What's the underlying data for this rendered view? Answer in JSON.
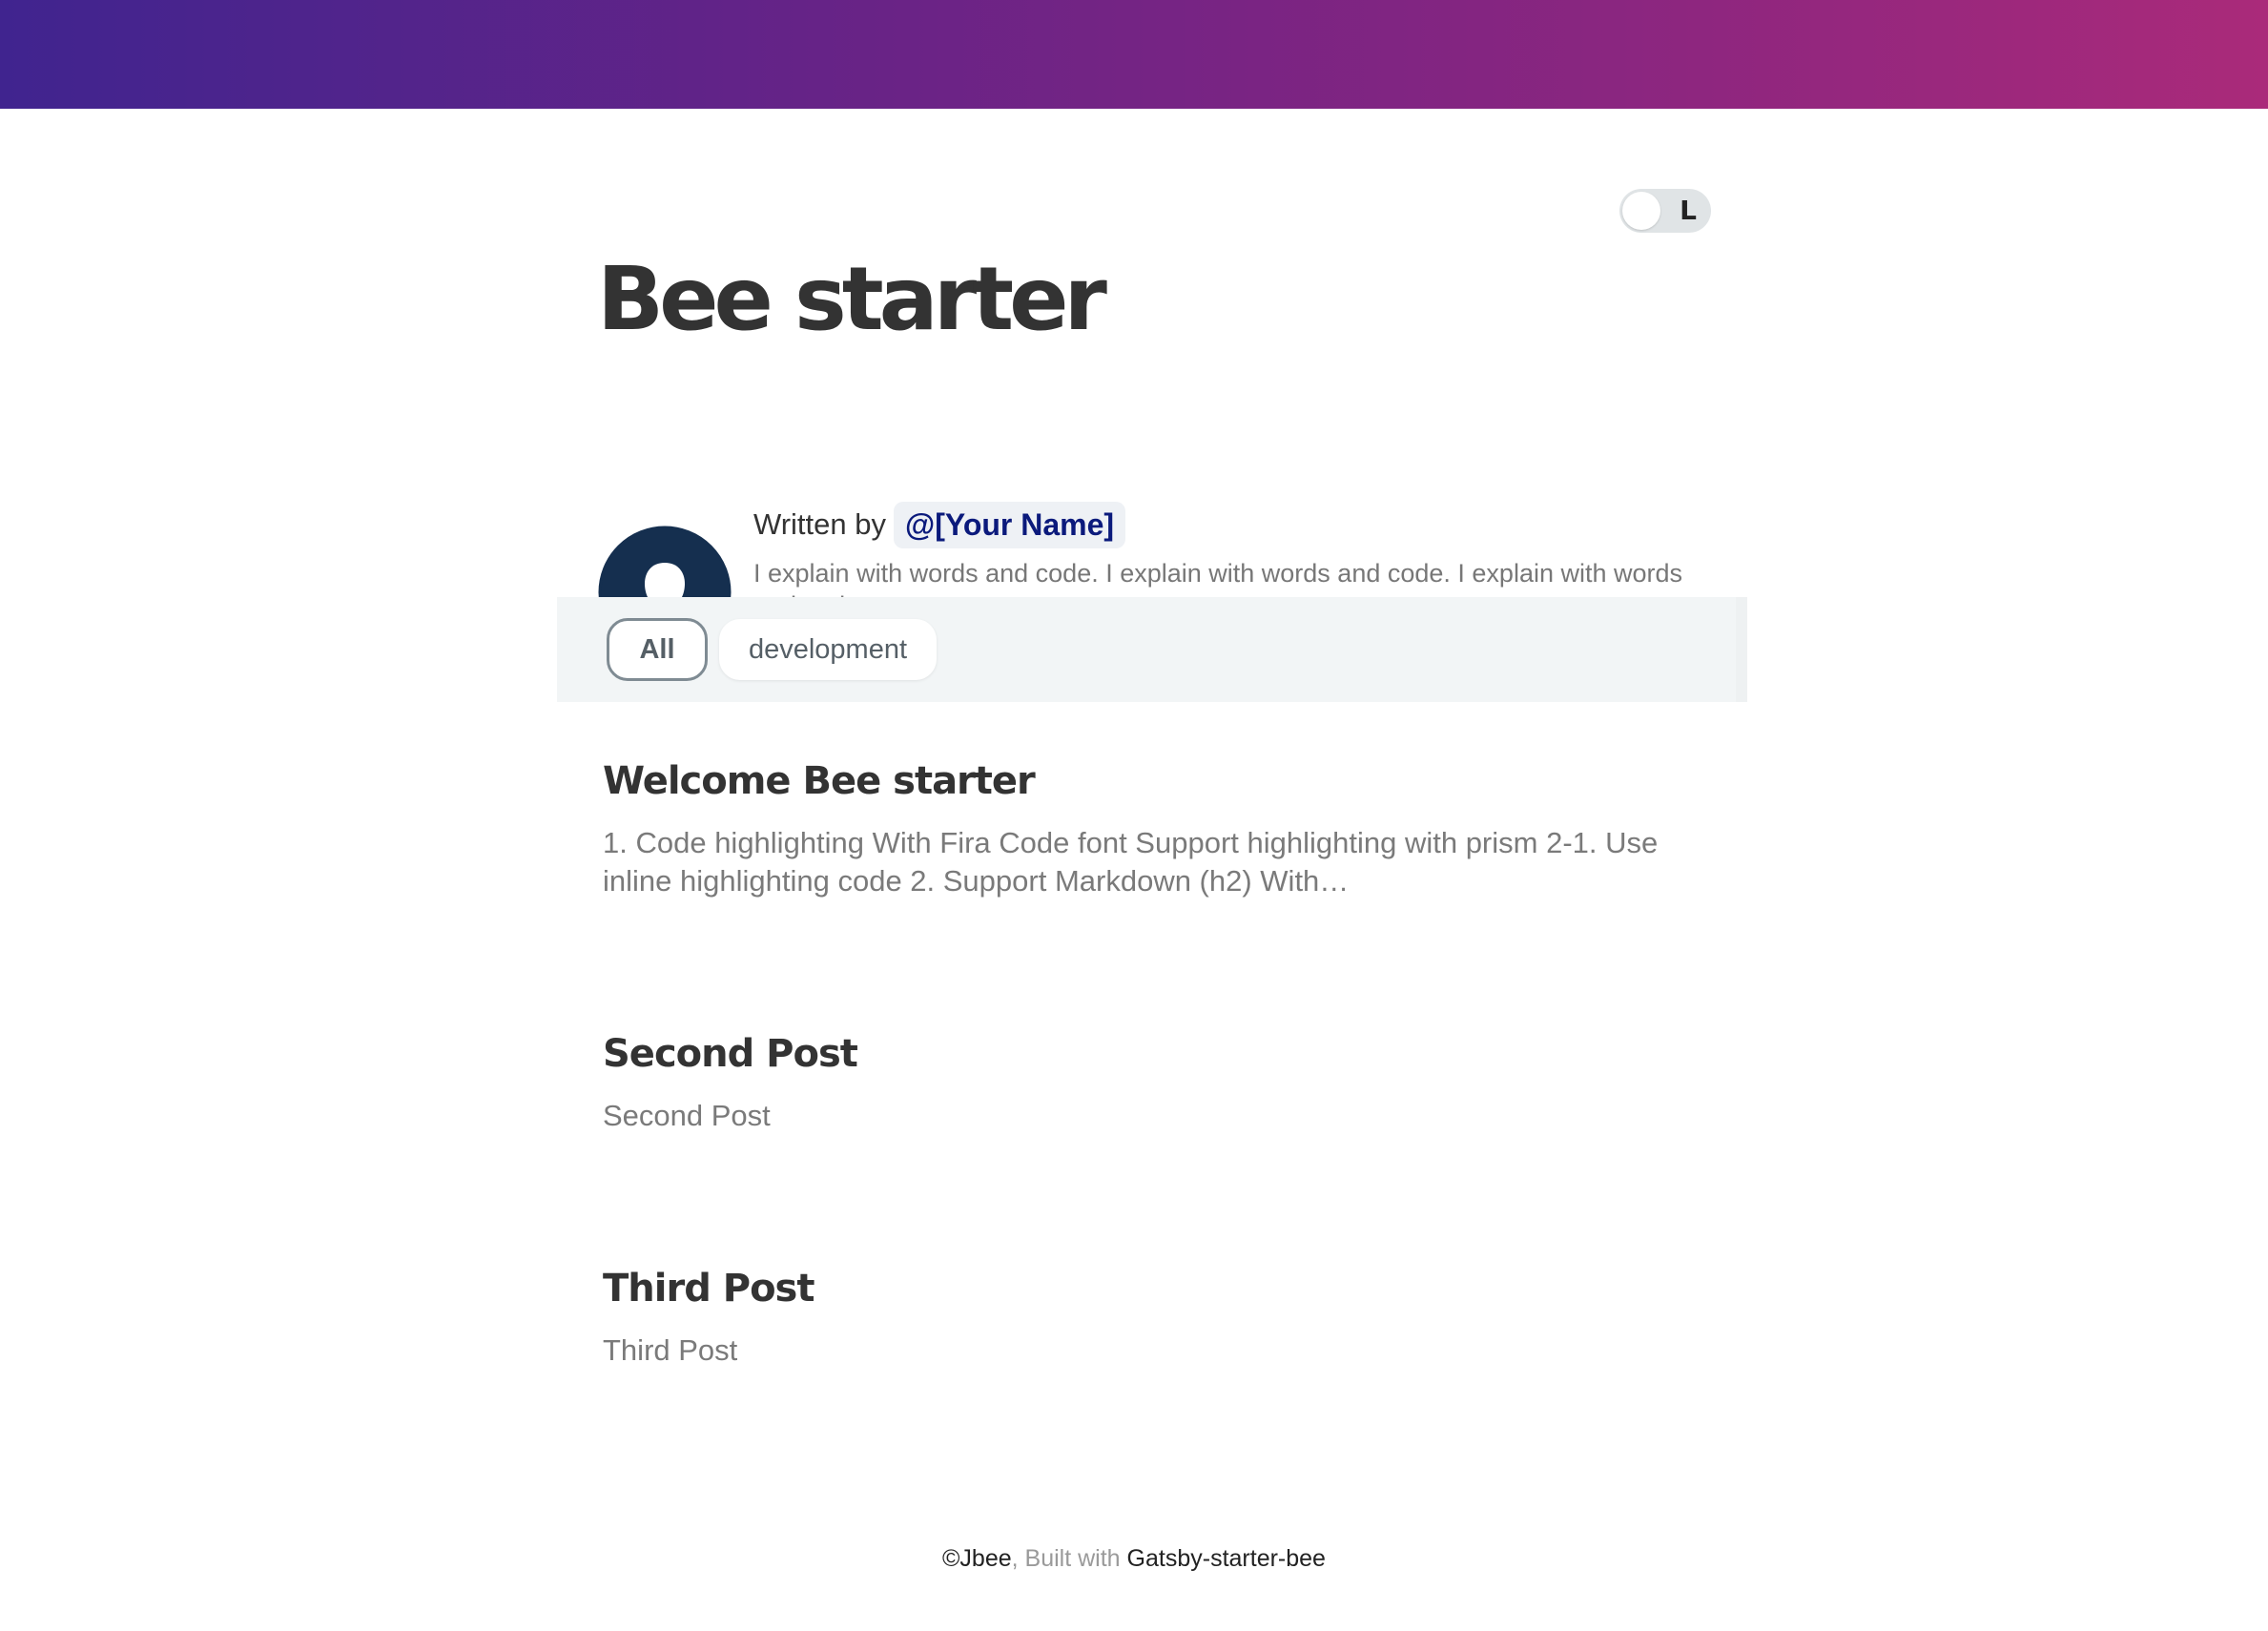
{
  "header": {
    "accent_gradient": [
      "#40248f",
      "#aa2a7a"
    ]
  },
  "theme_toggle": {
    "letter": "L"
  },
  "site": {
    "title": "Bee starter"
  },
  "bio": {
    "written_by": "Written by",
    "author": "@[Your Name]",
    "description": "I explain with words and code. I explain with words and code. I explain with words and code."
  },
  "categories": {
    "items": [
      "All",
      "development"
    ],
    "selected": "All"
  },
  "posts": [
    {
      "title": "Welcome Bee starter",
      "excerpt": "1. Code highlighting With Fira Code font Support highlighting with prism 2-1. Use inline highlighting code 2. Support Markdown (h2) With…"
    },
    {
      "title": "Second Post",
      "excerpt": "Second Post"
    },
    {
      "title": "Third Post",
      "excerpt": "Third Post"
    }
  ],
  "footer": {
    "copyright": "©Jbee",
    "built_with": ", Built with",
    "link": "Gatsby-starter-bee"
  }
}
